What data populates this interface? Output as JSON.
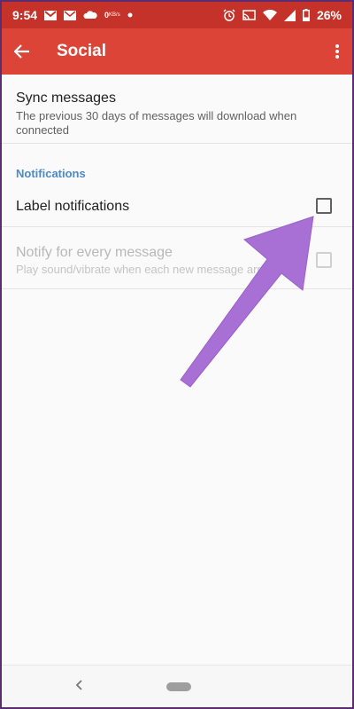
{
  "status_bar": {
    "time": "9:54",
    "net_speed_value": "0",
    "net_speed_unit": "KB/s",
    "battery": "26%"
  },
  "app_bar": {
    "title": "Social"
  },
  "settings": {
    "sync": {
      "title": "Sync messages",
      "subtitle": "The previous 30 days of messages will download when connected"
    },
    "notifications_header": "Notifications",
    "label_notifications": {
      "title": "Label notifications",
      "checked": false
    },
    "notify_every": {
      "title": "Notify for every message",
      "subtitle": "Play sound/vibrate when each new message arrives",
      "checked": false,
      "enabled": false
    }
  },
  "annotation": {
    "arrow_color": "#a86fd4"
  },
  "colors": {
    "app_bar": "#db4437",
    "status_bar": "#c5322a",
    "section_header": "#4a8bc8"
  }
}
